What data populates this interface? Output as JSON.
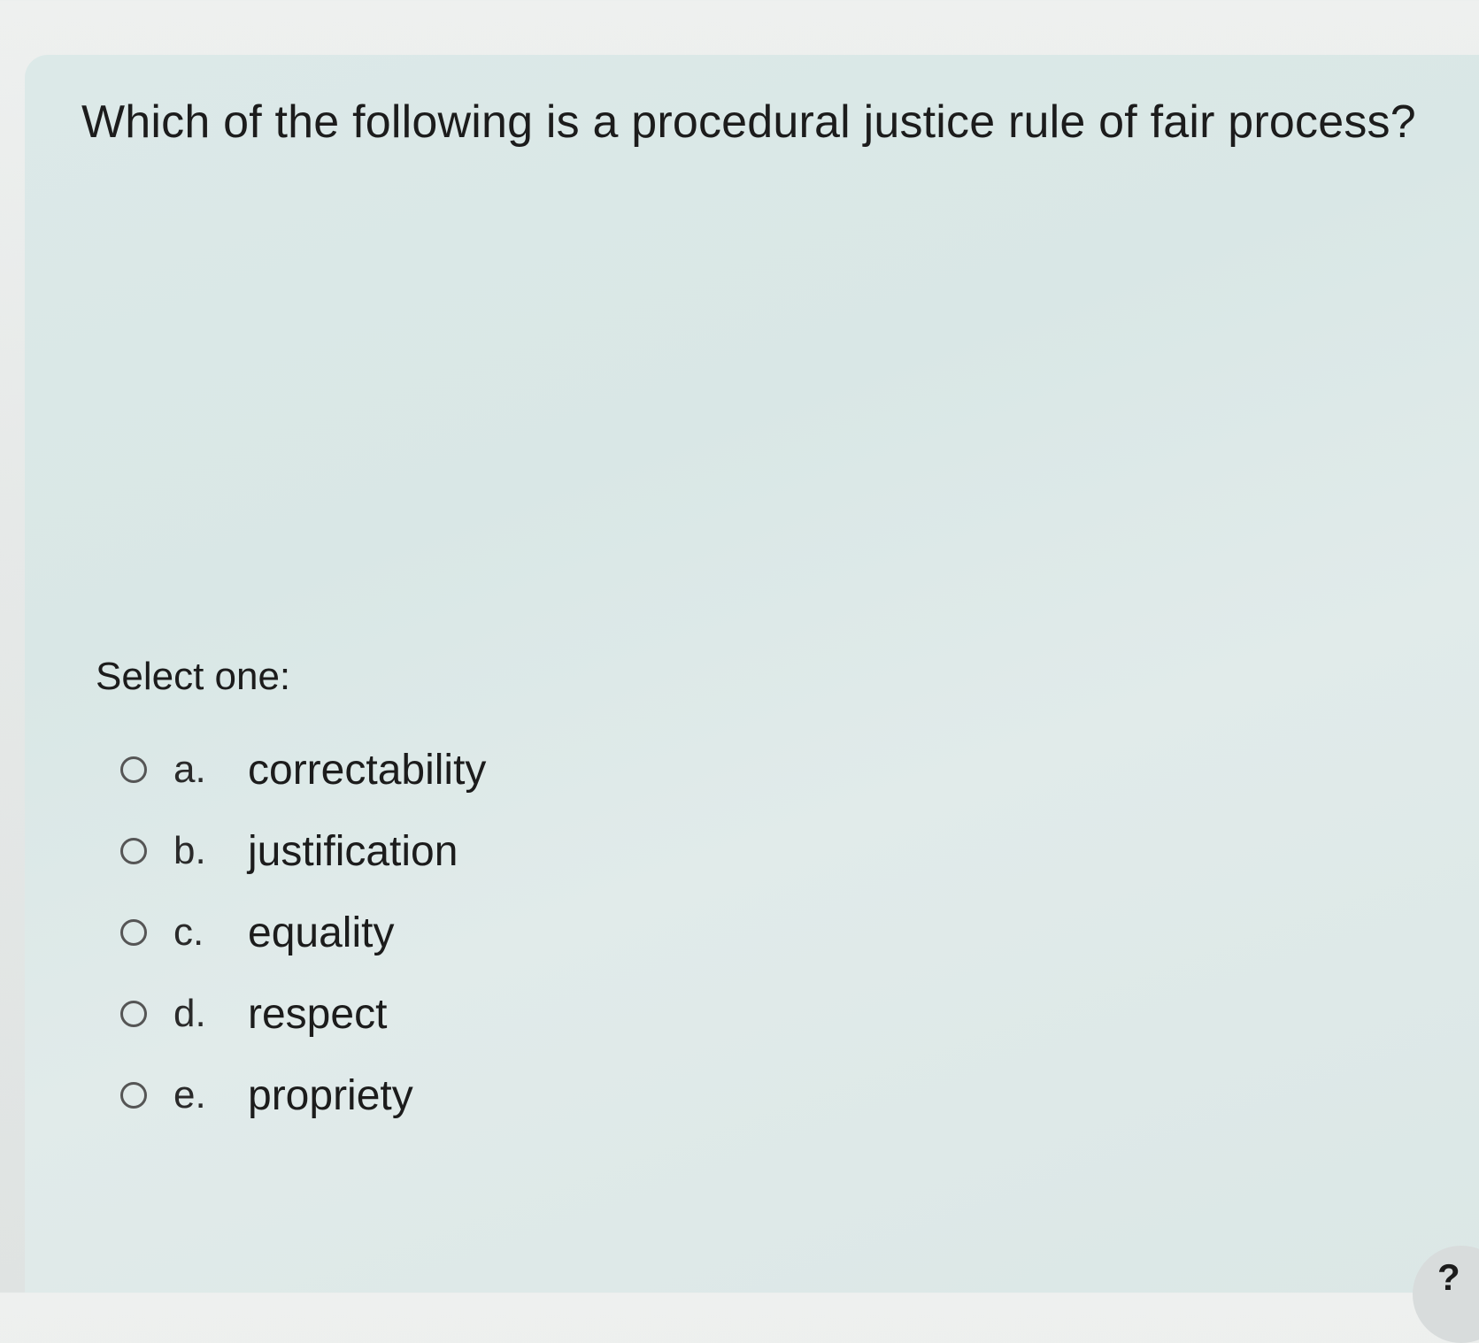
{
  "question": {
    "text": "Which of the following is a procedural justice rule of fair process?",
    "select_label": "Select one:"
  },
  "options": [
    {
      "letter": "a.",
      "text": "correctability",
      "selected": false
    },
    {
      "letter": "b.",
      "text": "justification",
      "selected": false
    },
    {
      "letter": "c.",
      "text": "equality",
      "selected": false
    },
    {
      "letter": "d.",
      "text": "respect",
      "selected": false
    },
    {
      "letter": "e.",
      "text": "propriety",
      "selected": false
    }
  ],
  "help": {
    "label": "?"
  }
}
